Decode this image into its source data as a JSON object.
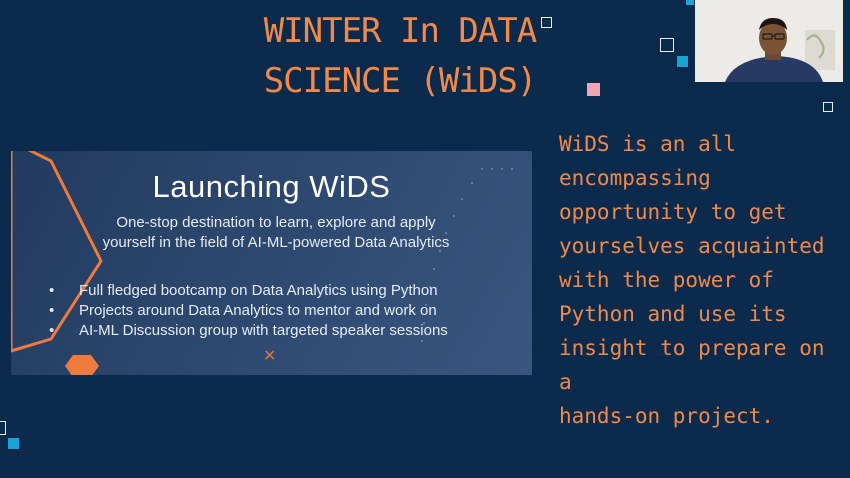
{
  "slide": {
    "title_line1": "WINTER In DATA",
    "title_line2": "SCIENCE (WiDS)",
    "banner": {
      "heading": "Launching WiDS",
      "subtitle_line1": "One-stop destination to learn, explore and apply",
      "subtitle_line2": "yourself in the field of AI-ML-powered Data Analytics",
      "bullets": [
        "Full fledged bootcamp on Data Analytics using Python",
        "Projects around Data Analytics to mentor and work on",
        "AI-ML Discussion group with targeted speaker sessions"
      ],
      "bullet_glyph": "•",
      "close_glyph": "×"
    },
    "description_lines": [
      "WiDS is an all",
      "encompassing",
      "opportunity to get",
      "yourselves acquainted",
      "with the power of",
      "Python and use its",
      "insight to prepare on a",
      "hands-on project."
    ]
  },
  "webcam": {
    "subject": "presenter-video"
  },
  "colors": {
    "background": "#0c2a4c",
    "accent_orange": "#f08a4a",
    "teal": "#1aa3d6",
    "pink": "#f2a6b4",
    "banner_bg": "#2f4a72"
  }
}
